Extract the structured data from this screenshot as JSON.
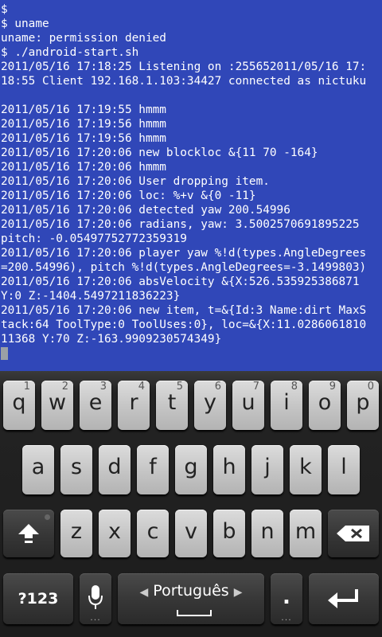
{
  "terminal": {
    "lines": [
      "$",
      "$ uname",
      "uname: permission denied",
      "$ ./android-start.sh",
      "2011/05/16 17:18:25 Listening on :255652011/05/16 17:",
      "18:55 Client 192.168.1.103:34427 connected as nictuku",
      "",
      "2011/05/16 17:19:55 hmmm",
      "2011/05/16 17:19:56 hmmm",
      "2011/05/16 17:19:56 hmmm",
      "2011/05/16 17:20:06 new blockloc &{11 70 -164}",
      "2011/05/16 17:20:06 hmmm",
      "2011/05/16 17:20:06 User dropping item.",
      "2011/05/16 17:20:06 loc: %+v &{0 -11}",
      "2011/05/16 17:20:06 detected yaw 200.54996",
      "2011/05/16 17:20:06 radians, yaw: 3.5002570691895225",
      "pitch: -0.05497752772359319",
      "2011/05/16 17:20:06 player yaw %!d(types.AngleDegrees",
      "=200.54996), pitch %!d(types.AngleDegrees=-3.1499803)",
      "2011/05/16 17:20:06 absVelocity &{X:526.535925386871",
      "Y:0 Z:-1404.5497211836223}",
      "2011/05/16 17:20:06 new item, t=&{Id:3 Name:dirt MaxS",
      "tack:64 ToolType:0 ToolUses:0}, loc=&{X:11.0286061810",
      "11368 Y:70 Z:-163.9909230574349}"
    ]
  },
  "keyboard": {
    "row1": [
      {
        "label": "q",
        "sub": "1"
      },
      {
        "label": "w",
        "sub": "2"
      },
      {
        "label": "e",
        "sub": "3"
      },
      {
        "label": "r",
        "sub": "4"
      },
      {
        "label": "t",
        "sub": "5"
      },
      {
        "label": "y",
        "sub": "6"
      },
      {
        "label": "u",
        "sub": "7"
      },
      {
        "label": "i",
        "sub": "8"
      },
      {
        "label": "o",
        "sub": "9"
      },
      {
        "label": "p",
        "sub": "0"
      }
    ],
    "row2": [
      "a",
      "s",
      "d",
      "f",
      "g",
      "h",
      "j",
      "k",
      "l"
    ],
    "row3": [
      "z",
      "x",
      "c",
      "v",
      "b",
      "n",
      "m"
    ],
    "symbols_label": "?123",
    "language_label": "Português",
    "period_label": ".",
    "period_hint": "...",
    "icons": {
      "shift": "shift-arrow-icon",
      "backspace": "backspace-icon",
      "mic": "microphone-icon",
      "enter": "enter-arrow-icon"
    }
  },
  "colors": {
    "terminal_bg": "#3047b8",
    "terminal_fg": "#ffffff"
  }
}
